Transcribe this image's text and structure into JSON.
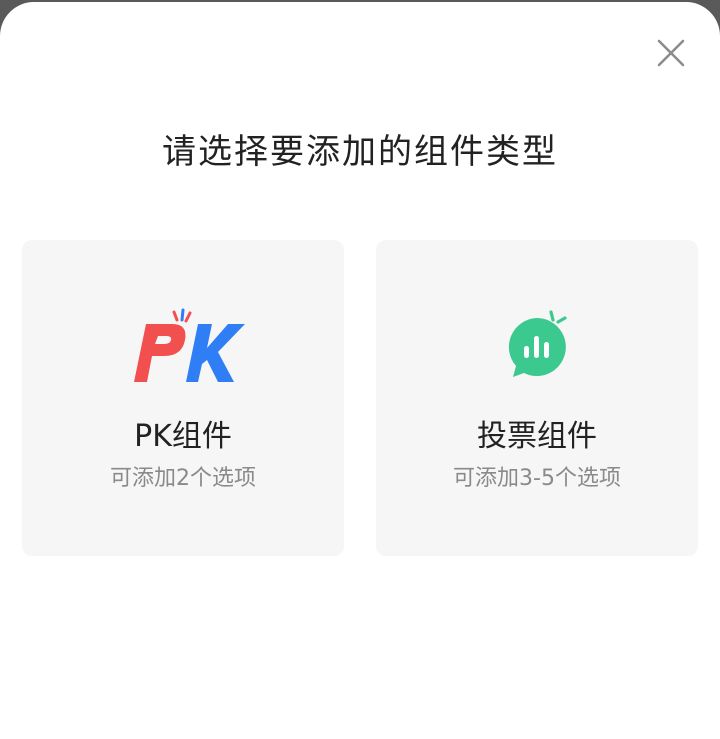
{
  "dialog": {
    "title": "请选择要添加的组件类型"
  },
  "icons": {
    "close": "close-icon",
    "pk": "pk-logo-icon",
    "vote": "vote-chat-icon"
  },
  "cards": [
    {
      "title": "PK组件",
      "subtitle": "可添加2个选项"
    },
    {
      "title": "投票组件",
      "subtitle": "可添加3-5个选项"
    }
  ],
  "colors": {
    "pk_red": "#f2504f",
    "pk_blue": "#2f7ef6",
    "vote_green": "#3cc98f",
    "card_bg": "#f6f6f6"
  }
}
